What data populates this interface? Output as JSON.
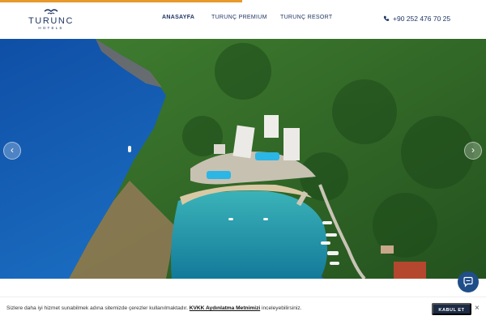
{
  "brand": {
    "name": "TURUNC",
    "tagline": "HOTELS",
    "logo_icon": "seagull-crest-icon"
  },
  "nav": {
    "items": [
      {
        "label": "ANASAYFA",
        "active": true
      },
      {
        "label": "TURUNÇ PREMIUM",
        "active": false
      },
      {
        "label": "TURUNÇ RESORT",
        "active": false
      }
    ]
  },
  "contact": {
    "phone": "+90 252 476 70 25",
    "icon": "phone-icon"
  },
  "hero": {
    "prev_icon": "‹",
    "next_icon": "›"
  },
  "chat": {
    "icon": "chat-bubble-icon"
  },
  "cookie": {
    "text_before": "Sizlere daha iyi hizmet sunabilmek adına sitemizde çerezler kullanılmaktadır. ",
    "link_text": "KVKK Aydınlatma Metnimizi",
    "text_after": " inceleyebilirsiniz.",
    "accept_label": "KABUL ET",
    "close_label": "×"
  },
  "colors": {
    "accent": "#e89a2c",
    "navy": "#1f3563",
    "sea": "#1f6fb8",
    "forest": "#2f6a2a"
  }
}
